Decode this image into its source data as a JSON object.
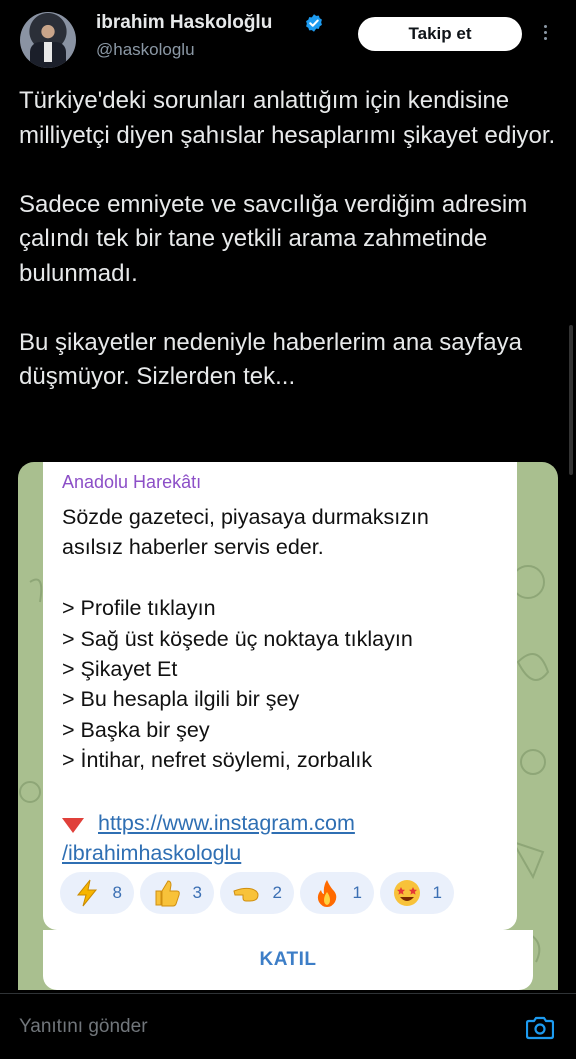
{
  "header": {
    "name": "ibrahim Haskoloğlu",
    "handle": "@haskologlu",
    "follow_label": "Takip et",
    "verified_color": "#1d9bf0"
  },
  "tweet": {
    "paragraphs": [
      "Türkiye'deki sorunları anlattığım için kendisine milliyetçi diyen şahıslar hesaplarımı şikayet ediyor.",
      "Sadece emniyete ve savcılığa verdiğim adresim çalındı tek bir tane yetkili arama zahmetinde bulunmadı.",
      "Bu şikayetler nedeniyle haberlerim ana sayfaya düşmüyor. Sizlerden tek..."
    ]
  },
  "media": {
    "channel_name": "Anadolu Harekâtı",
    "lines": [
      "Sözde gazeteci, piyasaya durmaksızın",
      "asılsız haberler servis eder."
    ],
    "steps": [
      "> Profile tıklayın",
      "> Sağ üst köşede üç noktaya tıklayın",
      "> Şikayet Et",
      "> Bu hesapla ilgili bir şey",
      "> Başka bir şey",
      "> İntihar, nefret söylemi, zorbalık"
    ],
    "link_line1": "https://www.instagram.com",
    "link_line2": "/ibrahimhaskologlu",
    "reactions": [
      {
        "icon": "lightning-emoji",
        "count": "8"
      },
      {
        "icon": "thumbs-up-emoji",
        "count": "3"
      },
      {
        "icon": "pointing-hand-emoji",
        "count": "2"
      },
      {
        "icon": "fire-emoji",
        "count": "1"
      },
      {
        "icon": "star-struck-emoji",
        "count": "1"
      }
    ],
    "join_label": "KATIL"
  },
  "reply": {
    "placeholder": "Yanıtını gönder"
  }
}
